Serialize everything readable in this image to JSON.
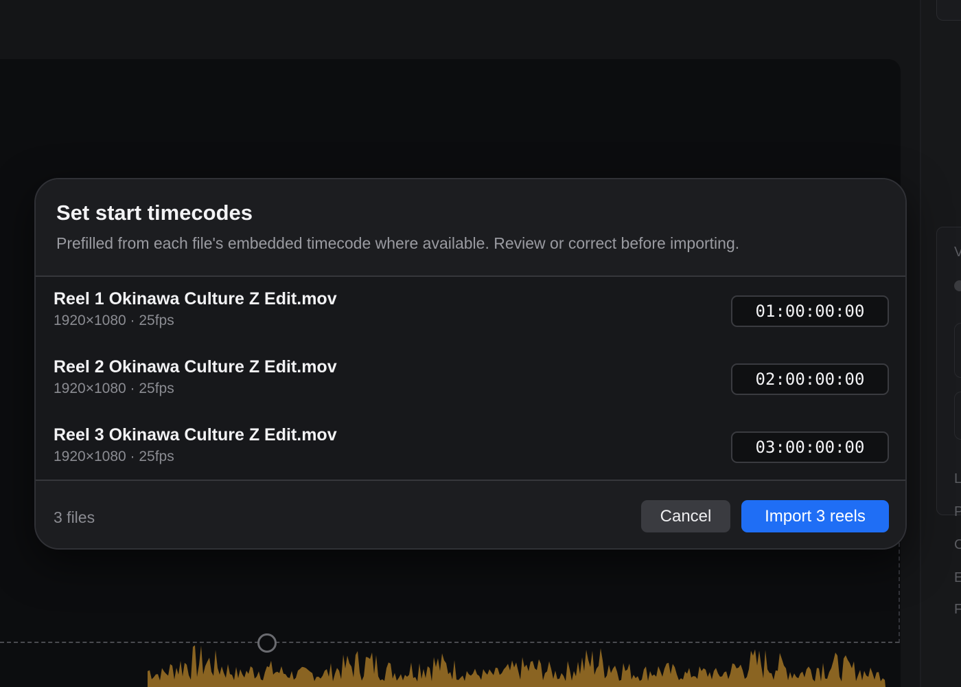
{
  "dialog": {
    "title": "Set start timecodes",
    "subtitle": "Prefilled from each file's embedded timecode where available. Review or correct before importing.",
    "files": [
      {
        "name": "Reel 1 Okinawa Culture Z Edit.mov",
        "meta": "1920×1080 · 25fps",
        "timecode": "01:00:00:00"
      },
      {
        "name": "Reel 2 Okinawa Culture Z Edit.mov",
        "meta": "1920×1080 · 25fps",
        "timecode": "02:00:00:00"
      },
      {
        "name": "Reel 3 Okinawa Culture Z Edit.mov",
        "meta": "1920×1080 · 25fps",
        "timecode": "03:00:00:00"
      }
    ],
    "file_count": "3 files",
    "cancel_label": "Cancel",
    "import_label": "Import 3 reels"
  },
  "right_panel": {
    "letters": [
      "V",
      "L",
      "P",
      "C",
      "E",
      "F"
    ]
  },
  "colors": {
    "accent": "#1f6ef5",
    "waveform": "#8a6422",
    "background": "#0c0d0f"
  }
}
